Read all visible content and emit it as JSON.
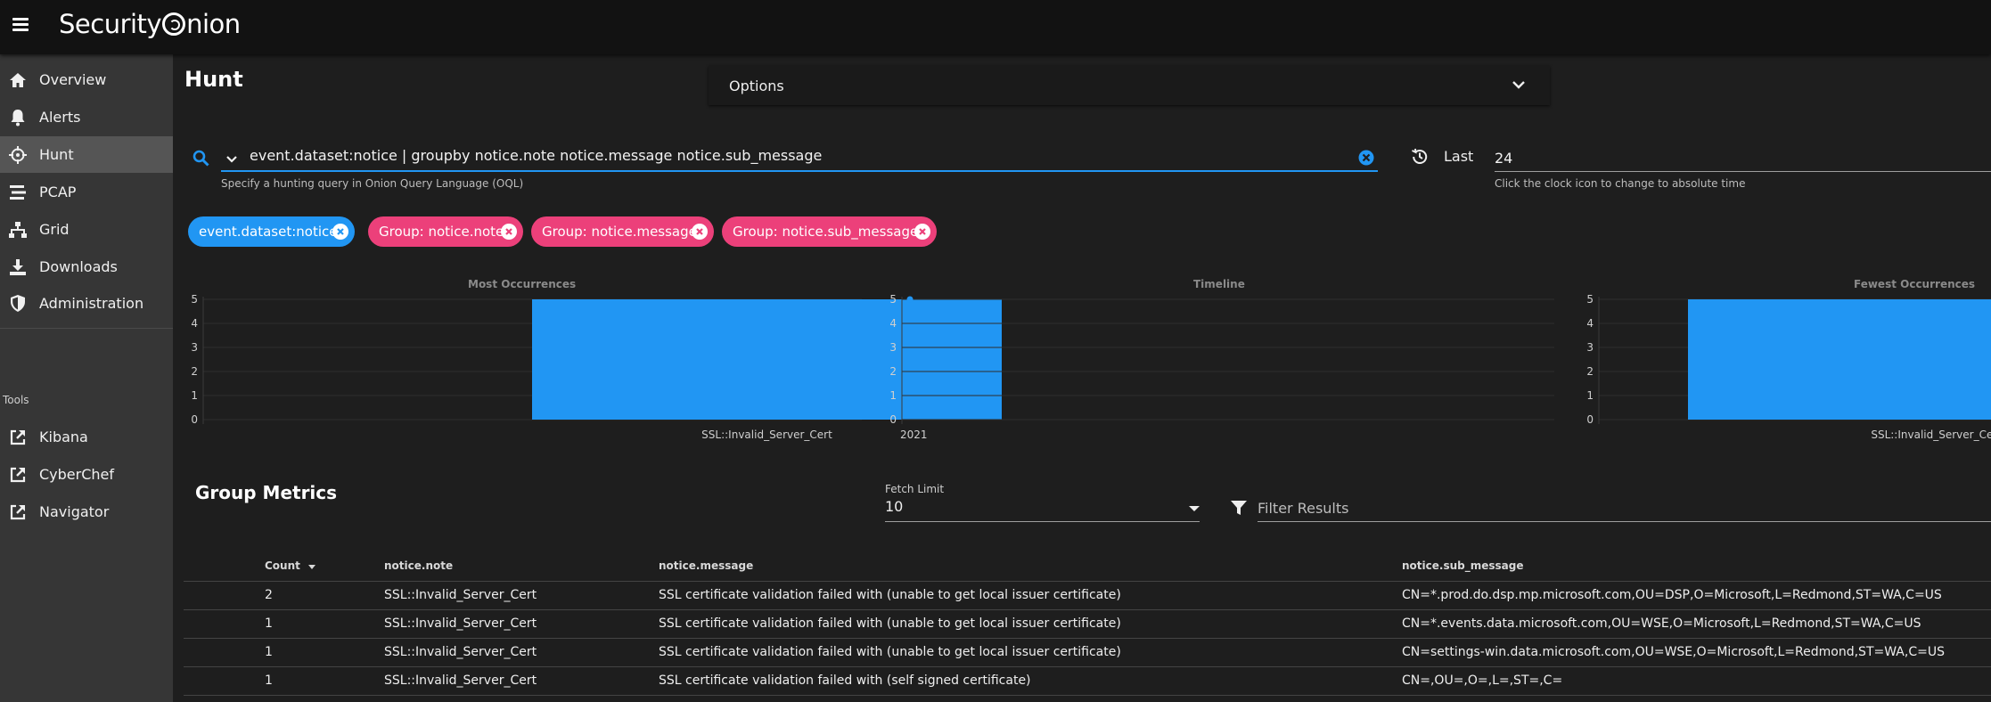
{
  "app": {
    "title": "Security Onion"
  },
  "sidebar": {
    "items": [
      {
        "label": "Overview",
        "icon": "home-icon"
      },
      {
        "label": "Alerts",
        "icon": "bell-icon"
      },
      {
        "label": "Hunt",
        "icon": "crosshairs-icon",
        "active": true
      },
      {
        "label": "PCAP",
        "icon": "stream-icon"
      },
      {
        "label": "Grid",
        "icon": "network-icon"
      },
      {
        "label": "Downloads",
        "icon": "download-icon"
      },
      {
        "label": "Administration",
        "icon": "shield-icon"
      }
    ],
    "tools_label": "Tools",
    "tools": [
      {
        "label": "Kibana",
        "icon": "external-link-icon"
      },
      {
        "label": "CyberChef",
        "icon": "external-link-icon"
      },
      {
        "label": "Navigator",
        "icon": "external-link-icon"
      }
    ]
  },
  "page": {
    "title": "Hunt"
  },
  "options": {
    "label": "Options"
  },
  "query": {
    "value": "event.dataset:notice | groupby notice.note notice.message notice.sub_message",
    "hint": "Specify a hunting query in Onion Query Language (OQL)"
  },
  "time": {
    "label": "Last",
    "value": "24",
    "hint": "Click the clock icon to change to absolute time"
  },
  "chips": [
    {
      "label": "event.dataset:notice",
      "color": "#2196f3"
    },
    {
      "label": "Group: notice.note",
      "color": "#ec407a"
    },
    {
      "label": "Group: notice.message",
      "color": "#ec407a"
    },
    {
      "label": "Group: notice.sub_message",
      "color": "#ec407a"
    }
  ],
  "chart_data": [
    {
      "type": "bar",
      "title": "Most Occurrences",
      "categories": [
        "SSL::Invalid_Server_Cert"
      ],
      "values": [
        5
      ],
      "yticks": [
        "0",
        "1",
        "2",
        "3",
        "4",
        "5"
      ],
      "ylim": [
        0,
        5
      ],
      "color": "#2196f3"
    },
    {
      "type": "line",
      "title": "Timeline",
      "x": [
        "2021"
      ],
      "values": [
        5
      ],
      "yticks": [
        "0",
        "1",
        "2",
        "3",
        "4",
        "5"
      ],
      "ylim": [
        0,
        5
      ],
      "color": "#2196f3"
    },
    {
      "type": "bar",
      "title": "Fewest Occurrences",
      "categories": [
        "SSL::Invalid_Server_Cert"
      ],
      "values": [
        5
      ],
      "yticks": [
        "0",
        "1",
        "2",
        "3",
        "4",
        "5"
      ],
      "ylim": [
        0,
        5
      ],
      "color": "#2196f3"
    }
  ],
  "group_metrics": {
    "title": "Group Metrics",
    "fetch_limit_label": "Fetch Limit",
    "fetch_limit_value": "10",
    "filter_placeholder": "Filter Results",
    "columns": [
      "Count",
      "notice.note",
      "notice.message",
      "notice.sub_message"
    ],
    "rows": [
      [
        "2",
        "SSL::Invalid_Server_Cert",
        "SSL certificate validation failed with (unable to get local issuer certificate)",
        "CN=*.prod.do.dsp.mp.microsoft.com,OU=DSP,O=Microsoft,L=Redmond,ST=WA,C=US"
      ],
      [
        "1",
        "SSL::Invalid_Server_Cert",
        "SSL certificate validation failed with (unable to get local issuer certificate)",
        "CN=*.events.data.microsoft.com,OU=WSE,O=Microsoft,L=Redmond,ST=WA,C=US"
      ],
      [
        "1",
        "SSL::Invalid_Server_Cert",
        "SSL certificate validation failed with (unable to get local issuer certificate)",
        "CN=settings-win.data.microsoft.com,OU=WSE,O=Microsoft,L=Redmond,ST=WA,C=US"
      ],
      [
        "1",
        "SSL::Invalid_Server_Cert",
        "SSL certificate validation failed with (self signed certificate)",
        "CN=,OU=,O=,L=,ST=,C="
      ]
    ]
  }
}
